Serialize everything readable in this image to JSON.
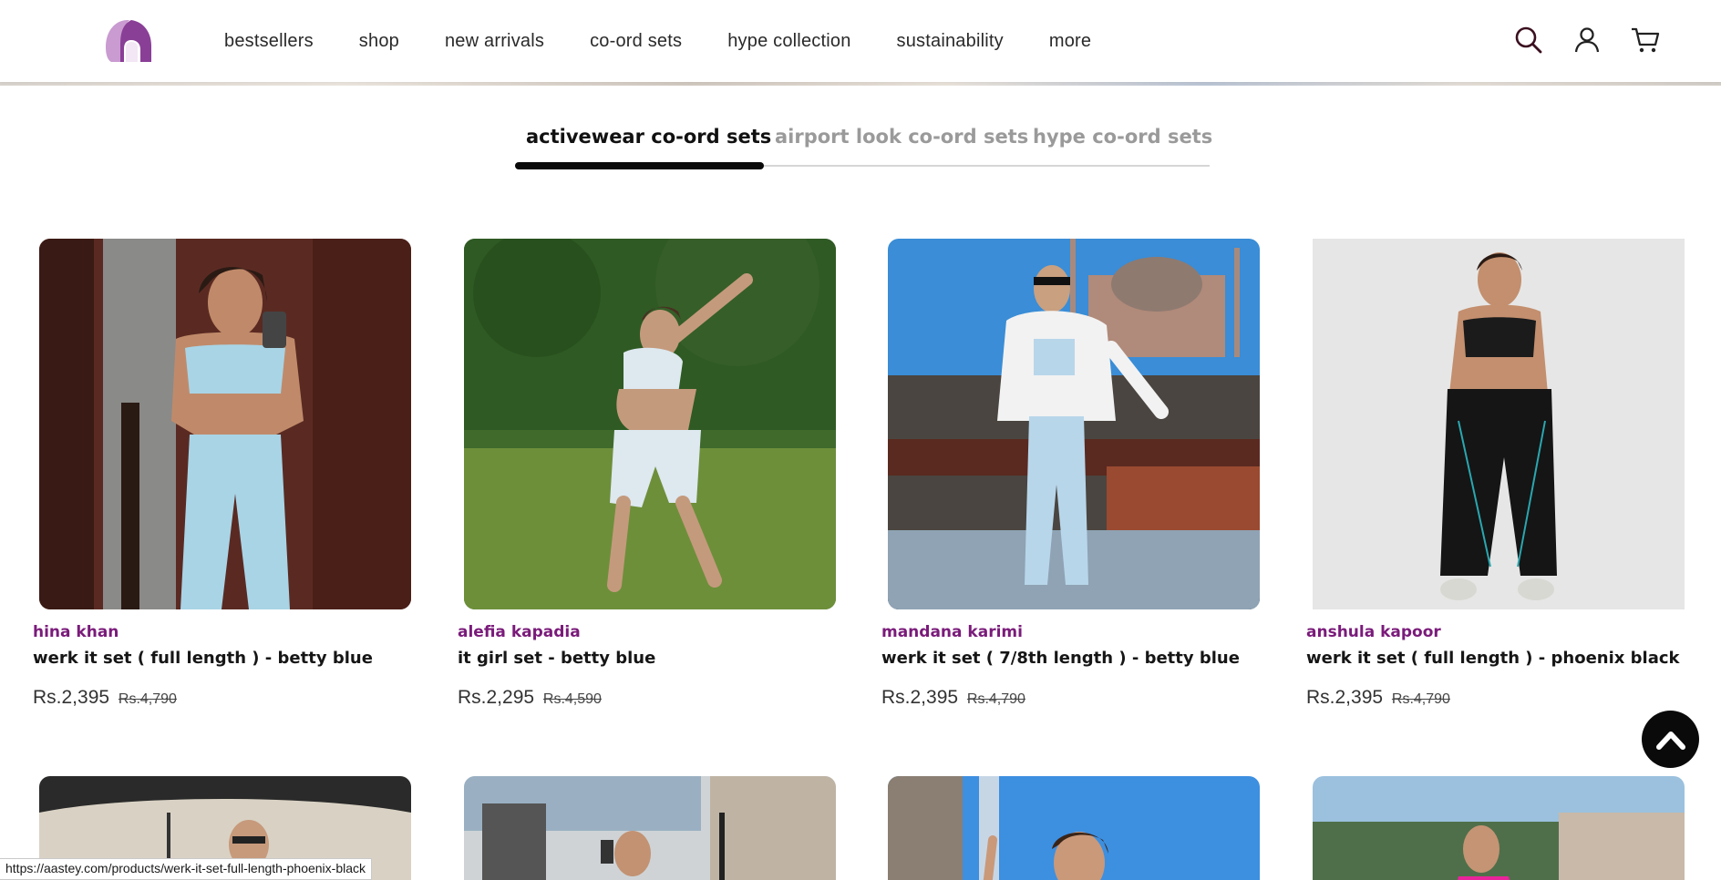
{
  "header": {
    "logo_alt": "aastey",
    "nav": [
      "bestsellers",
      "shop",
      "new arrivals",
      "co-ord sets",
      "hype collection",
      "sustainability",
      "more"
    ],
    "icons": [
      "search-icon",
      "account-icon",
      "cart-icon"
    ]
  },
  "tabs": {
    "items": [
      "activewear co-ord sets",
      "airport look co-ord sets",
      "hype co-ord sets"
    ],
    "active": "activewear co-ord sets"
  },
  "products": [
    {
      "brand": "hina khan",
      "title": "werk it set ( full length ) - betty blue",
      "price": "Rs.2,395",
      "compare": "Rs.4,790"
    },
    {
      "brand": "alefia kapadia",
      "title": "it girl set - betty blue",
      "price": "Rs.2,295",
      "compare": "Rs.4,590"
    },
    {
      "brand": "mandana karimi",
      "title": "werk it set ( 7/8th length ) - betty blue",
      "price": "Rs.2,395",
      "compare": "Rs.4,790"
    },
    {
      "brand": "anshula kapoor",
      "title": "werk it set ( full length ) - phoenix black",
      "price": "Rs.2,395",
      "compare": "Rs.4,790"
    }
  ],
  "colors": {
    "brand_purple": "#7a1b7a",
    "logo_light": "#c99bd0",
    "logo_dark": "#8a3f97",
    "tab_active": "#0a0a0a",
    "tab_inactive": "#9a9a9a"
  },
  "status_bar": {
    "url": "https://aastey.com/products/werk-it-set-full-length-phoenix-black"
  }
}
